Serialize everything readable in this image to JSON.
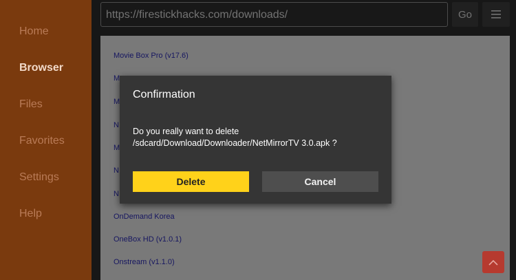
{
  "sidebar": {
    "items": [
      {
        "label": "Home"
      },
      {
        "label": "Browser"
      },
      {
        "label": "Files"
      },
      {
        "label": "Favorites"
      },
      {
        "label": "Settings"
      },
      {
        "label": "Help"
      }
    ],
    "active": "Browser"
  },
  "toolbar": {
    "url": "https://firestickhacks.com/downloads/",
    "go_label": "Go",
    "menu_icon": "hamburger-menu-icon"
  },
  "page": {
    "links": [
      {
        "text": "Movie Box Pro (v17.6)"
      },
      {
        "text": "M"
      },
      {
        "text": "M"
      },
      {
        "text": "N"
      },
      {
        "text": "M"
      },
      {
        "text": "N"
      },
      {
        "text": "N"
      },
      {
        "text": "OnDemand Korea"
      },
      {
        "text": "OneBox HD (v1.0.1)"
      },
      {
        "text": "Onstream (v1.1.0)"
      }
    ]
  },
  "dialog": {
    "title": "Confirmation",
    "message": "Do you really want to delete /sdcard/Download/Downloader/NetMirrorTV 3.0.apk ?",
    "delete_label": "Delete",
    "cancel_label": "Cancel"
  },
  "colors": {
    "sidebar_bg": "#7a3a0e",
    "sidebar_text": "#b97b57",
    "sidebar_active_text": "#f2d9c8",
    "link": "#2b2bb0",
    "delete_button": "#ffd21a",
    "cancel_button": "#4e4e4e",
    "scroll_top_button": "#b63a2f"
  },
  "scroll_top_icon": "chevron-up-icon"
}
